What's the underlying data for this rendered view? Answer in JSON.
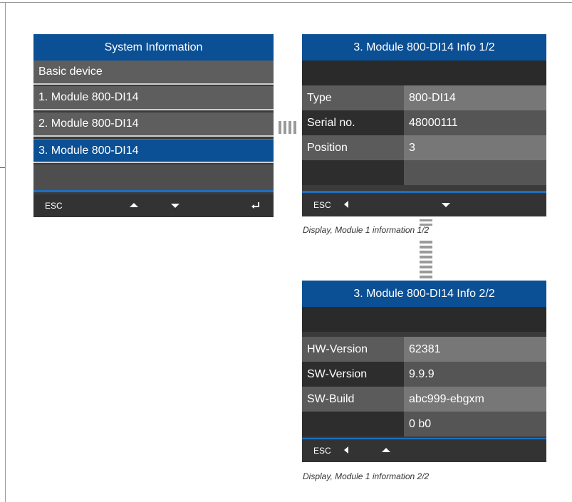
{
  "system_info": {
    "title": "System Information",
    "items": [
      {
        "label": "Basic device"
      },
      {
        "label": "1. Module 800-DI14"
      },
      {
        "label": "2. Module 800-DI14"
      },
      {
        "label": "3. Module 800-DI14",
        "selected": true
      }
    ],
    "footer": {
      "esc": "ESC",
      "icons": [
        "up-arrow",
        "down-arrow",
        "enter"
      ]
    }
  },
  "info_page_1": {
    "title": "3. Module 800-DI14 Info 1/2",
    "rows": [
      {
        "key": "Type",
        "value": "800-DI14"
      },
      {
        "key": "Serial no.",
        "value": "48000111"
      },
      {
        "key": "Position",
        "value": "3"
      }
    ],
    "footer": {
      "esc": "ESC",
      "icons": [
        "left-arrow",
        "down-arrow"
      ]
    },
    "caption": "Display, Module 1 information 1/2"
  },
  "info_page_2": {
    "title": "3. Module 800-DI14 Info 2/2",
    "rows": [
      {
        "key": "HW-Version",
        "value": "62381"
      },
      {
        "key": "SW-Version",
        "value": "9.9.9"
      },
      {
        "key": "SW-Build",
        "value": "abc999-ebgxm"
      },
      {
        "key": "",
        "value": "0 b0"
      }
    ],
    "footer": {
      "esc": "ESC",
      "icons": [
        "left-arrow",
        "up-arrow"
      ]
    },
    "caption": "Display, Module 1 information 2/2"
  },
  "colors": {
    "title_bar": "#0b4f94",
    "selected_row": "#0b4f94",
    "accent_line": "#1f6fc0",
    "screen_bg": "#3b3b3b"
  }
}
